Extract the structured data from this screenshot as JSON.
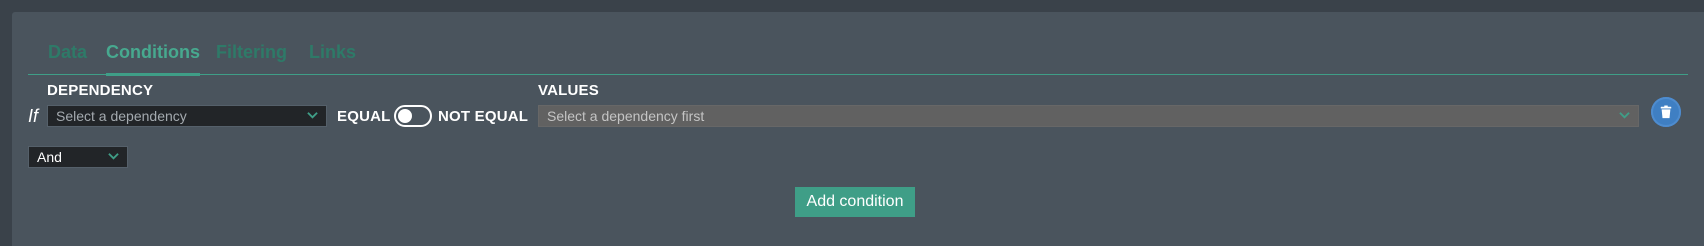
{
  "tabs": [
    {
      "label": "Data",
      "active": false
    },
    {
      "label": "Conditions",
      "active": true
    },
    {
      "label": "Filtering",
      "active": false
    },
    {
      "label": "Links",
      "active": false
    }
  ],
  "condition": {
    "prefix": "If",
    "dependency_label": "DEPENDENCY",
    "dependency_placeholder": "Select a dependency",
    "equal_label": "EQUAL",
    "not_equal_label": "NOT EQUAL",
    "toggle_state": "equal",
    "values_label": "VALUES",
    "values_placeholder": "Select a dependency first"
  },
  "logic_select": {
    "value": "And"
  },
  "add_button": {
    "label": "Add condition"
  },
  "colors": {
    "accent": "#3f9e87",
    "tab_inactive": "#2e7a68",
    "panel_bg": "#4a545d",
    "page_bg": "#3a424a",
    "delete_button": "#3f7fc3"
  },
  "icons": {
    "dependency_chevron": "chevron-down-icon",
    "values_chevron": "chevron-down-icon",
    "logic_chevron": "chevron-down-icon",
    "delete": "trash-icon"
  }
}
